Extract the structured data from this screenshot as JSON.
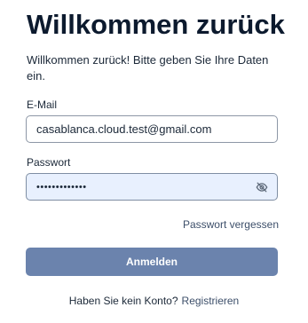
{
  "header": {
    "title": "Willkommen zurück",
    "subtitle": "Willkommen zurück! Bitte geben Sie Ihre Daten ein."
  },
  "form": {
    "email": {
      "label": "E-Mail",
      "value": "casablanca.cloud.test@gmail.com"
    },
    "password": {
      "label": "Passwort",
      "masked_value": "•••••••••••••",
      "toggle_icon": "eye-slash-icon"
    },
    "forgot_password_label": "Passwort vergessen",
    "submit_label": "Anmelden"
  },
  "footer": {
    "prompt": "Haben Sie kein Konto?",
    "register_label": "Registrieren"
  },
  "colors": {
    "primary_button": "#6b83ad",
    "autofill_background": "#e8f0fe",
    "heading_text": "#0c1a2e",
    "link_text": "#3d4f6a"
  }
}
